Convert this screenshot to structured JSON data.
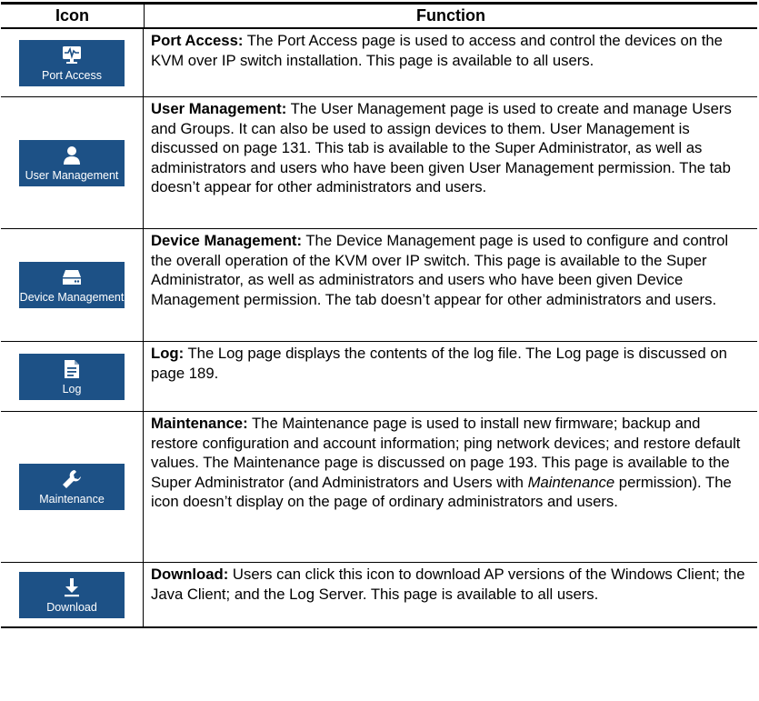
{
  "table": {
    "headers": {
      "icon": "Icon",
      "function": "Function"
    },
    "rows": [
      {
        "icon_name": "monitor-pulse-icon",
        "button_label": "Port Access",
        "title": "Port Access:",
        "text": " The Port Access page is used to access and control the devices on the KVM over IP switch installation. This page is available to all users."
      },
      {
        "icon_name": "user-icon",
        "button_label": "User Management",
        "title": "User Management:",
        "text": " The User Management page is used to create and manage Users and Groups. It can also be used to assign devices to them. User Management is discussed on page 131. This tab is available to the Super Administrator, as well as administrators and users who have been given User Management permission. The tab doesn’t appear for other administrators and users."
      },
      {
        "icon_name": "server-drive-icon",
        "button_label": "Device Management",
        "title": "Device Management:",
        "text": " The Device Management page is used to configure and control the overall operation of the KVM over IP switch. This page is available to the Super Administrator, as well as administrators and users who have been given Device Management permission. The tab doesn’t appear for other administrators and users."
      },
      {
        "icon_name": "document-icon",
        "button_label": "Log",
        "title": "Log:",
        "text": " The Log page displays the contents of the log file. The Log page is discussed on page 189."
      },
      {
        "icon_name": "wrench-icon",
        "button_label": "Maintenance",
        "title": "Maintenance:",
        "text_before": " The Maintenance page is used to install new firmware; backup and restore configuration and account information; ping network devices; and restore default values. The Maintenance page is discussed on page 193. This page is available to the Super Administrator (and Administrators and Users with ",
        "text_italic": "Maintenance",
        "text_after": " permission). The icon doesn’t display on the page of ordinary administrators and users."
      },
      {
        "icon_name": "download-icon",
        "button_label": "Download",
        "title": "Download:",
        "text": " Users can click this icon to download AP versions of the Windows Client; the Java Client; and the Log Server. This page is available to all users."
      }
    ]
  },
  "colors": {
    "button_bg": "#1d5186",
    "button_text": "#ffffff",
    "rule": "#000000"
  }
}
